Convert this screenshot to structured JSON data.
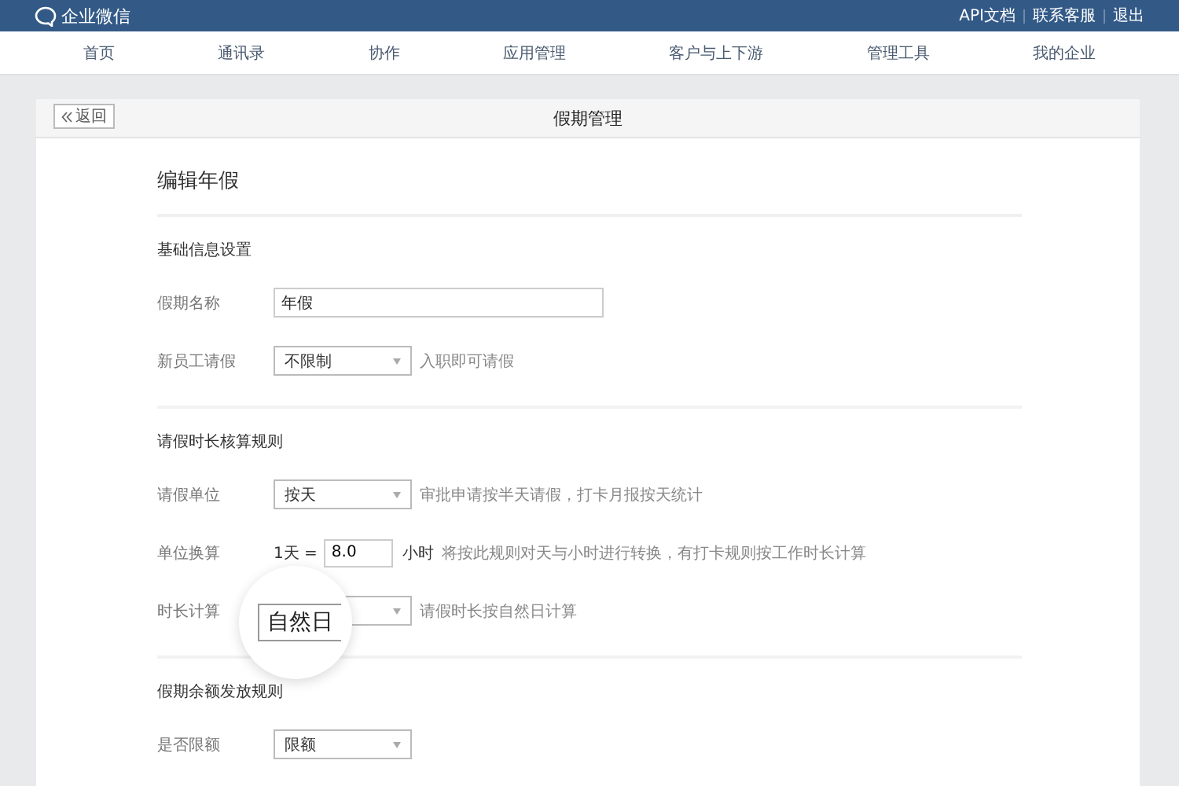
{
  "brand": {
    "name": "企业微信"
  },
  "top_links": [
    "API文档",
    "联系客服",
    "退出"
  ],
  "nav": [
    "首页",
    "通讯录",
    "协作",
    "应用管理",
    "客户与上下游",
    "管理工具",
    "我的企业"
  ],
  "page": {
    "back_button": "返回",
    "title": "假期管理"
  },
  "form": {
    "title": "编辑年假",
    "sections": [
      {
        "heading": "基础信息设置",
        "rows": [
          {
            "kind": "input",
            "label": "假期名称",
            "value": "年假"
          },
          {
            "kind": "select",
            "label": "新员工请假",
            "value": "不限制",
            "hint": "入职即可请假"
          }
        ]
      },
      {
        "heading": "请假时长核算规则",
        "rows": [
          {
            "kind": "select",
            "label": "请假单位",
            "value": "按天",
            "hint": "审批申请按半天请假，打卡月报按天统计"
          },
          {
            "kind": "conversion",
            "label": "单位换算",
            "prefix": "1天 =",
            "value": "8.0",
            "unit": "小时",
            "hint": "将按此规则对天与小时进行转换，有打卡规则按工作时长计算"
          },
          {
            "kind": "select",
            "label": "时长计算",
            "value": "自然日",
            "magnified": true,
            "hint": "请假时长按自然日计算"
          }
        ]
      },
      {
        "heading": "假期余额发放规则",
        "rows": [
          {
            "kind": "select",
            "label": "是否限额",
            "value": "限额"
          }
        ]
      }
    ]
  }
}
